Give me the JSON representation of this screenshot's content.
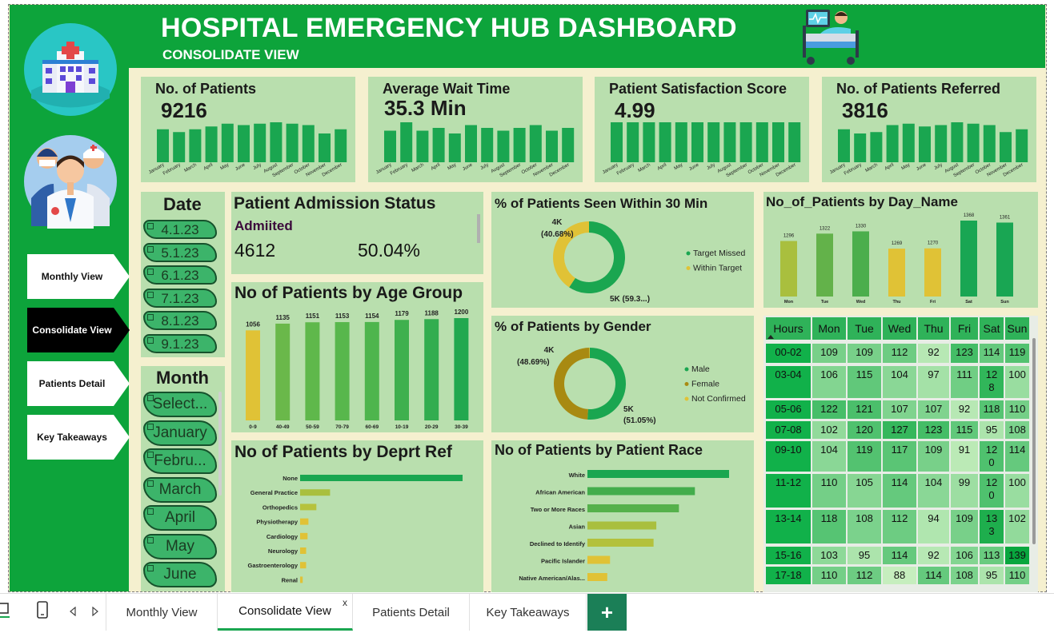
{
  "header": {
    "title": "HOSPITAL EMERGENCY HUB DASHBOARD",
    "subtitle": "CONSOLIDATE VIEW"
  },
  "nav": {
    "buttons": [
      {
        "label": "Monthly View",
        "active": false
      },
      {
        "label": "Consolidate View",
        "active": true
      },
      {
        "label": "Patients Detail",
        "active": false
      },
      {
        "label": "Key Takeaways",
        "active": false
      }
    ]
  },
  "months_short": [
    "January",
    "February",
    "March",
    "April",
    "May",
    "June",
    "July",
    "August",
    "September",
    "October",
    "November",
    "December"
  ],
  "kpis": [
    {
      "title": "No. of Patients",
      "value": "9216",
      "bars": [
        31,
        29,
        31,
        33,
        35,
        34,
        35,
        36,
        35,
        34,
        28,
        31
      ]
    },
    {
      "title": "Average Wait Time",
      "value": "35.3 Min",
      "bars": [
        35.2,
        35.5,
        35.2,
        35.3,
        35.1,
        35.4,
        35.3,
        35.2,
        35.3,
        35.4,
        35.2,
        35.3
      ]
    },
    {
      "title": "Patient Satisfaction Score",
      "value": "4.99",
      "bars": [
        4.99,
        4.99,
        4.99,
        4.99,
        4.99,
        4.99,
        4.99,
        4.99,
        4.99,
        4.99,
        4.99,
        4.99
      ]
    },
    {
      "title": "No. of Patients Referred",
      "value": "3816",
      "bars": [
        33,
        30,
        31,
        36,
        37,
        35,
        36,
        38,
        37,
        36,
        31,
        33
      ]
    }
  ],
  "date_slicer": {
    "title": "Date",
    "items": [
      "4.1.23",
      "5.1.23",
      "6.1.23",
      "7.1.23",
      "8.1.23",
      "9.1.23"
    ]
  },
  "month_slicer": {
    "title": "Month",
    "items": [
      "Select...",
      "January",
      "Febru...",
      "March",
      "April",
      "May",
      "June"
    ]
  },
  "admission": {
    "title": "Patient Admission Status",
    "label": "Admiited",
    "count": "4612",
    "percent": "50.04%"
  },
  "seen30": {
    "title": "% of Patients Seen Within 30 Min",
    "legend": [
      {
        "label": "Target Missed",
        "color": "#1aa650"
      },
      {
        "label": "Within Target",
        "color": "#e0c236"
      }
    ],
    "slices": [
      {
        "label": "5K (59.3...)",
        "value": 59.32,
        "color": "#1aa650"
      },
      {
        "label": "4K",
        "sublabel": "(40.68%)",
        "value": 40.68,
        "color": "#e0c236"
      }
    ]
  },
  "gender": {
    "title": "% of Patients by Gender",
    "legend": [
      {
        "label": "Male",
        "color": "#1aa650"
      },
      {
        "label": "Female",
        "color": "#a88a12"
      },
      {
        "label": "Not Confirmed",
        "color": "#e0c236"
      }
    ],
    "slices": [
      {
        "label": "5K",
        "sublabel": "(51.05%)",
        "value": 51.05,
        "color": "#1aa650"
      },
      {
        "label": "4K",
        "sublabel": "(48.69%)",
        "value": 48.69,
        "color": "#a88a12"
      },
      {
        "label": "",
        "value": 0.26,
        "color": "#e0c236"
      }
    ]
  },
  "chart_data": [
    {
      "type": "bar",
      "title": "No of Patients by Age Group",
      "categories": [
        "0-9",
        "40-49",
        "50-59",
        "70-79",
        "60-69",
        "10-19",
        "20-29",
        "30-39"
      ],
      "values": [
        1056,
        1135,
        1151,
        1153,
        1154,
        1179,
        1188,
        1200
      ],
      "colors": [
        "#e0c236",
        "#6ab84a",
        "#5fb84b",
        "#58b74c",
        "#4eb54d",
        "#3fb04e",
        "#32ad4f",
        "#22a84f"
      ]
    },
    {
      "type": "bar",
      "title": "No_of_Patients by Day_Name",
      "categories": [
        "Mon",
        "Tue",
        "Wed",
        "Thu",
        "Fri",
        "Sat",
        "Sun"
      ],
      "values": [
        1296,
        1322,
        1330,
        1269,
        1270,
        1368,
        1361
      ],
      "colors": [
        "#a9bf3e",
        "#63b24a",
        "#4bae4c",
        "#e0c236",
        "#e0c236",
        "#19a653",
        "#19a653"
      ]
    },
    {
      "type": "bar",
      "orientation": "horizontal",
      "title": "No of Patients by Deprt Ref",
      "categories": [
        "None",
        "General Practice",
        "Orthopedics",
        "Physiotherapy",
        "Cardiology",
        "Neurology",
        "Gastroenterology",
        "Renal"
      ],
      "values": [
        5400,
        995,
        540,
        276,
        248,
        200,
        199,
        86
      ],
      "colors": [
        "#1aa650",
        "#a9bf3e",
        "#b6c23c",
        "#e0c236",
        "#e0c236",
        "#e0c236",
        "#e0c236",
        "#e0c236"
      ]
    },
    {
      "type": "bar",
      "orientation": "horizontal",
      "title": "No of Patients by Patient Race",
      "categories": [
        "White",
        "African American",
        "Two or More Races",
        "Asian",
        "Declined to Identify",
        "Pacific Islander",
        "Native American/Alas..."
      ],
      "values": [
        2570,
        1950,
        1660,
        1250,
        1200,
        410,
        360
      ],
      "colors": [
        "#1aa650",
        "#43ad4c",
        "#55b14b",
        "#a9bf3e",
        "#b3c13c",
        "#e0c236",
        "#e0c236"
      ]
    }
  ],
  "heatmap": {
    "columns": [
      "Hours",
      "Mon",
      "Tue",
      "Wed",
      "Thu",
      "Fri",
      "Sat",
      "Sun"
    ],
    "rows": [
      {
        "hour": "00-02",
        "vals": [
          "109",
          "109",
          "112",
          "92",
          "123",
          "114",
          "119"
        ]
      },
      {
        "hour": "03-04",
        "vals": [
          "106",
          "115",
          "104",
          "97",
          "111",
          "12\n8",
          "100"
        ]
      },
      {
        "hour": "05-06",
        "vals": [
          "122",
          "121",
          "107",
          "107",
          "92",
          "118",
          "110"
        ]
      },
      {
        "hour": "07-08",
        "vals": [
          "102",
          "120",
          "127",
          "123",
          "115",
          "95",
          "108"
        ]
      },
      {
        "hour": "09-10",
        "vals": [
          "104",
          "119",
          "117",
          "109",
          "91",
          "12\n0",
          "114"
        ]
      },
      {
        "hour": "11-12",
        "vals": [
          "110",
          "105",
          "114",
          "104",
          "99",
          "12\n0",
          "100"
        ]
      },
      {
        "hour": "13-14",
        "vals": [
          "118",
          "108",
          "112",
          "94",
          "109",
          "13\n3",
          "102"
        ]
      },
      {
        "hour": "15-16",
        "vals": [
          "103",
          "95",
          "114",
          "92",
          "106",
          "113",
          "139"
        ]
      },
      {
        "hour": "17-18",
        "vals": [
          "110",
          "112",
          "88",
          "114",
          "108",
          "95",
          "110"
        ]
      }
    ]
  },
  "tabs": [
    {
      "label": "Monthly View"
    },
    {
      "label": "Consolidate View",
      "active": true
    },
    {
      "label": "Patients Detail"
    },
    {
      "label": "Key Takeaways"
    }
  ],
  "tab_close": "x",
  "add_tab": "+",
  "icons": [
    "desktop-icon",
    "mobile-icon",
    "prev-arrow-icon",
    "next-arrow-icon",
    "hospital-logo-icon",
    "doctors-icon",
    "patient-bed-icon"
  ]
}
